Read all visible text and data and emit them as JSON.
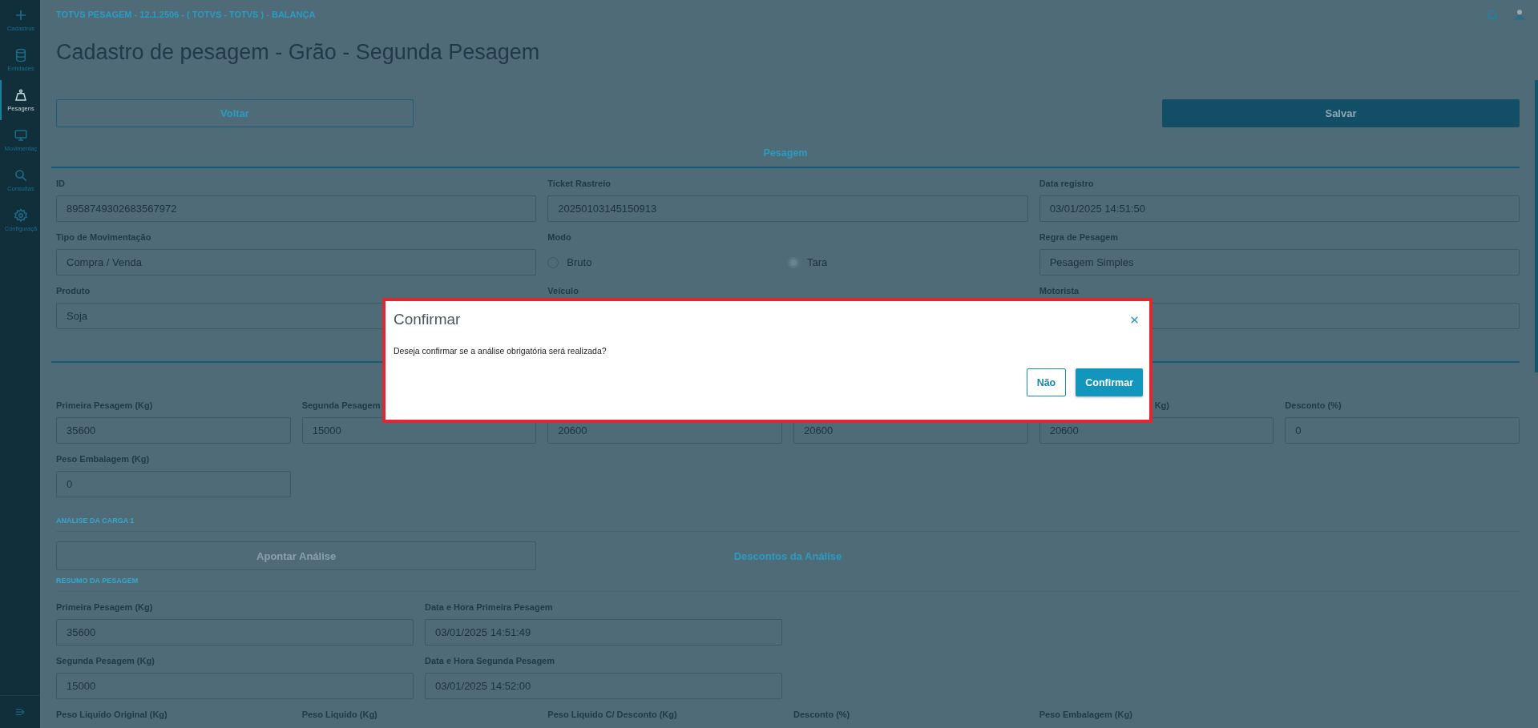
{
  "sidebar": {
    "items": [
      {
        "label": "Cadastros",
        "selected": false
      },
      {
        "label": "Entidades",
        "selected": false
      },
      {
        "label": "Pesagens",
        "selected": true
      },
      {
        "label": "Movimentaç",
        "selected": false
      },
      {
        "label": "Consultas",
        "selected": false
      },
      {
        "label": "Configuraçã",
        "selected": false
      }
    ]
  },
  "header": {
    "title": "TOTVS PESAGEM - 12.1.2506 - ( TOTVS - TOTVS ) - BALANÇA"
  },
  "page": {
    "title": "Cadastro de pesagem - Grão - Segunda Pesagem"
  },
  "actions": [
    {
      "label": "Voltar",
      "kind": "outline"
    },
    {
      "label": "Salvar",
      "kind": "primary"
    }
  ],
  "section": {
    "title": "Pesagem"
  },
  "rows": [
    [
      {
        "kind": "input",
        "label": "ID",
        "value": "8958749302683567972"
      },
      {
        "kind": "input",
        "label": "Ticket Rastreio",
        "value": "20250103145150913"
      },
      {
        "kind": "input",
        "label": "Data registro",
        "value": "03/01/2025 14:51:50"
      }
    ],
    [
      {
        "kind": "input",
        "label": "Tipo de Movimentação",
        "value": "Compra / Venda"
      },
      {
        "kind": "radio",
        "label": "Modo",
        "options": [
          {
            "label": "Bruto",
            "selected": false
          },
          {
            "label": "Tara",
            "selected": true
          }
        ]
      },
      {
        "kind": "input",
        "label": "Regra de Pesagem",
        "value": "Pesagem Simples"
      }
    ],
    [
      {
        "kind": "input",
        "label": "Produto",
        "value": "Soja"
      },
      {
        "kind": "label",
        "label": "Veículo"
      },
      {
        "kind": "input",
        "label": "Motorista"
      }
    ]
  ],
  "weights": [
    {
      "label": "Primeira Pesagem (Kg)",
      "value": "35600"
    },
    {
      "label": "Segunda Pesagem",
      "value": "15000"
    },
    {
      "value": "20600"
    },
    {
      "value": "20600"
    },
    {
      "label": "Kg)",
      "value": "20600"
    },
    {
      "label": "Desconto (%)",
      "value": "0"
    }
  ],
  "packaging": {
    "label": "Peso Embalagem (Kg)",
    "value": "0"
  },
  "analysis": {
    "title": "ANÁLISE DA CARGA 1",
    "button": {
      "label": "Apontar Análise",
      "disabled": true
    },
    "link": "Descontos da Análise"
  },
  "summary": {
    "title": "RESUMO DA PESAGEM",
    "rows": [
      [
        {
          "label": "Primeira Pesagem (Kg)",
          "value": "35600"
        },
        {
          "label": "Data e Hora Primeira Pesagem",
          "value": "03/01/2025 14:51:49"
        }
      ],
      [
        {
          "label": "Segunda Pesagem (Kg)",
          "value": "15000"
        },
        {
          "label": "Data e Hora Segunda Pesagem",
          "value": "03/01/2025 14:52:00"
        }
      ]
    ],
    "footer_labels": [
      "Peso Liquido Original (Kg)",
      "Peso Liquido (Kg)",
      "Peso Liquido C/ Desconto (Kg)",
      "Desconto (%)",
      "Peso Embalagem (Kg)"
    ]
  },
  "dialog": {
    "title": "Confirmar",
    "message": "Deseja confirmar se a análise obrigatória será realizada?",
    "buttons": [
      {
        "label": "Não",
        "kind": "outline"
      },
      {
        "label": "Confirmar",
        "kind": "primary"
      }
    ]
  }
}
